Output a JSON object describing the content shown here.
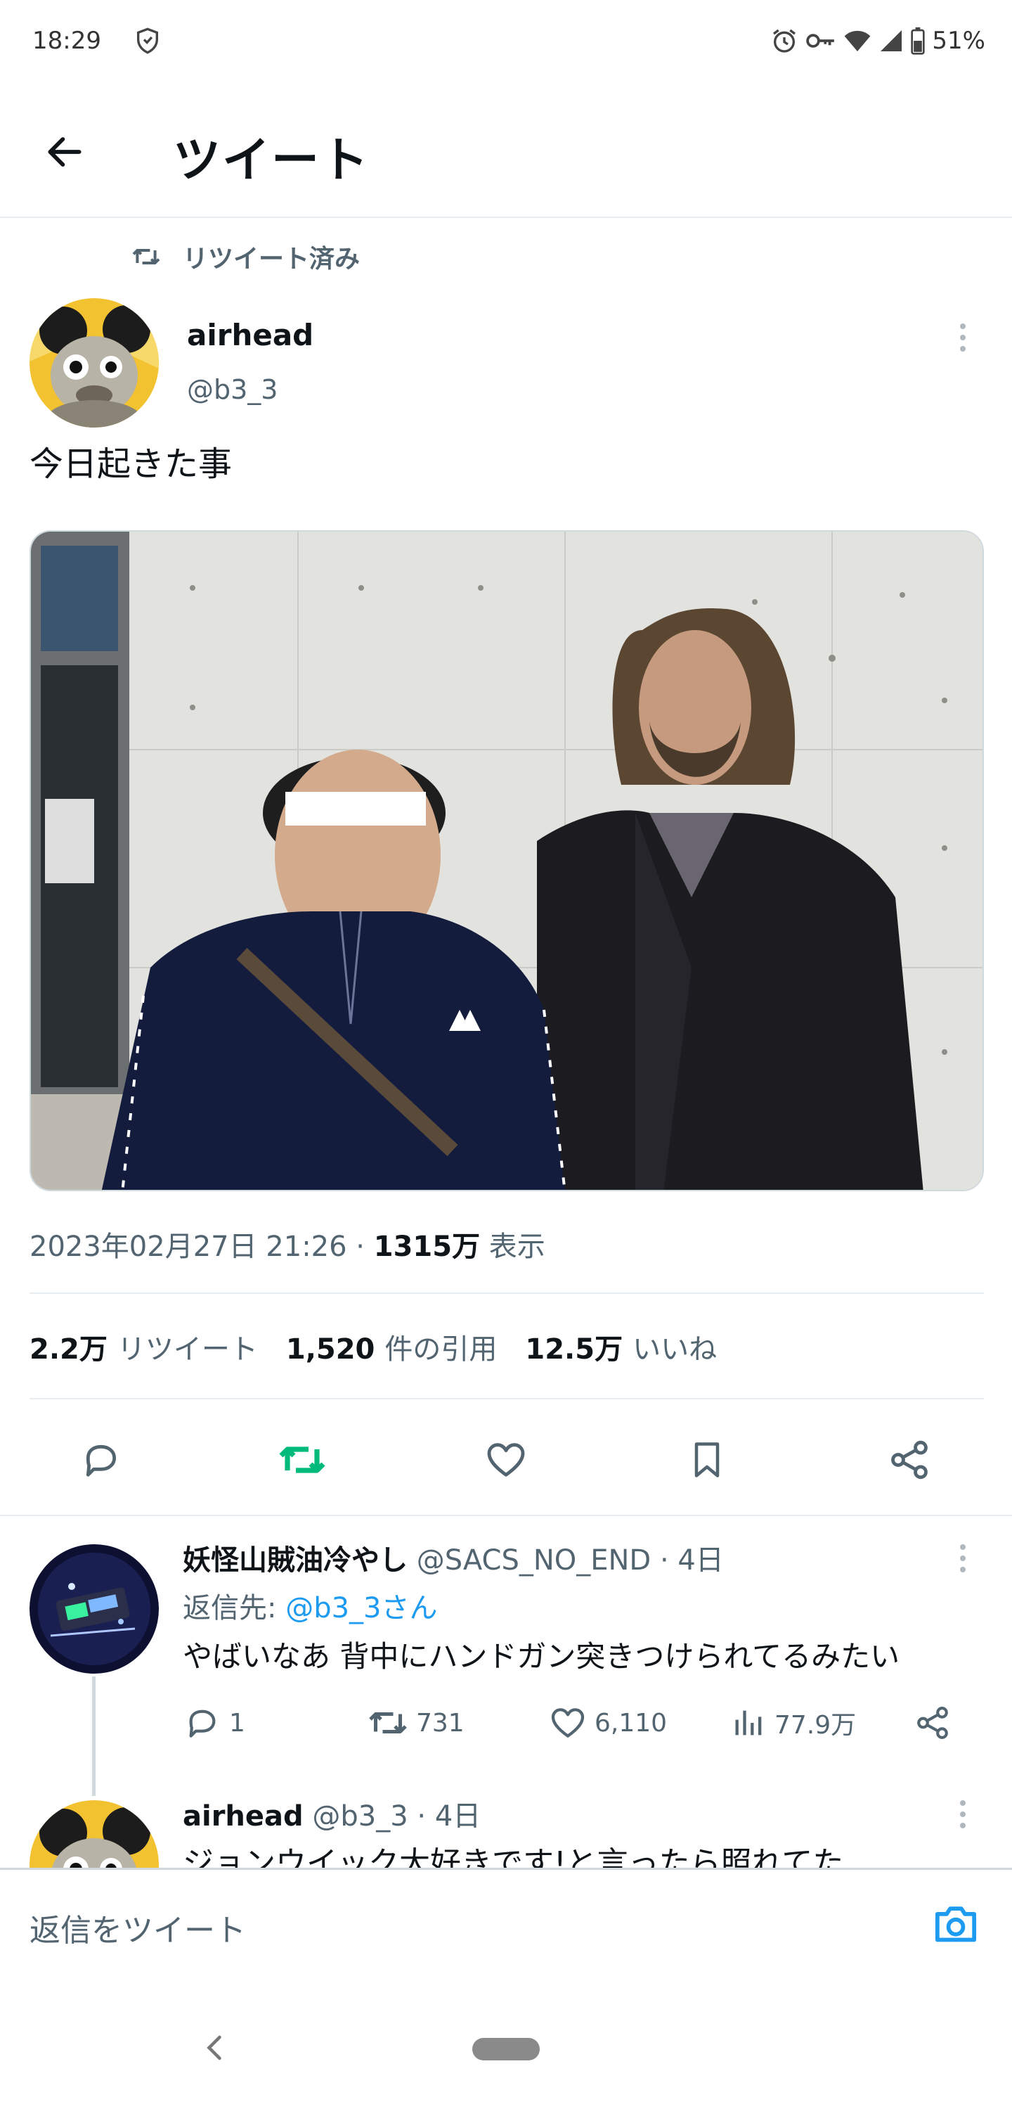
{
  "status_bar": {
    "time": "18:29",
    "battery": "51%",
    "icons": [
      "shield-icon",
      "alarm-icon",
      "vpn-key-icon",
      "wifi-icon",
      "signal-icon",
      "battery-icon"
    ]
  },
  "header": {
    "title": "ツイート",
    "back_icon": "arrow-left-icon"
  },
  "retweet_indicator": {
    "label": "リツイート済み"
  },
  "tweet": {
    "author_name": "airhead",
    "author_handle": "@b3_3",
    "text": "今日起きた事",
    "timestamp": "2023年02月27日 21:26 · ",
    "views_count": "1315万",
    "views_label": " 表示",
    "stats": {
      "retweets_count": "2.2万",
      "retweets_label": "リツイート",
      "quotes_count": "1,520",
      "quotes_label": "件の引用",
      "likes_count": "12.5万",
      "likes_label": "いいね"
    },
    "retweeted_color": "#00ba7c"
  },
  "replies": [
    {
      "name": "妖怪山賊油冷やし",
      "meta": " @SACS_NO_END · 4日",
      "reply_to_label": "返信先: ",
      "reply_to_handle": "@b3_3さん",
      "text": "やばいなあ 背中にハンドガン突きつけられてるみたい",
      "replies_count": "1",
      "retweets_count": "731",
      "likes_count": "6,110",
      "views_count": "77.9万"
    },
    {
      "name": "airhead",
      "meta": " @b3_3 · 4日",
      "text": "ジョンウイック大好きです!と言ったら照れてた"
    }
  ],
  "compose": {
    "placeholder": "返信をツイート"
  },
  "colors": {
    "link": "#1d9bf0",
    "secondary_text": "#536471",
    "divider": "#e6ecf0"
  }
}
